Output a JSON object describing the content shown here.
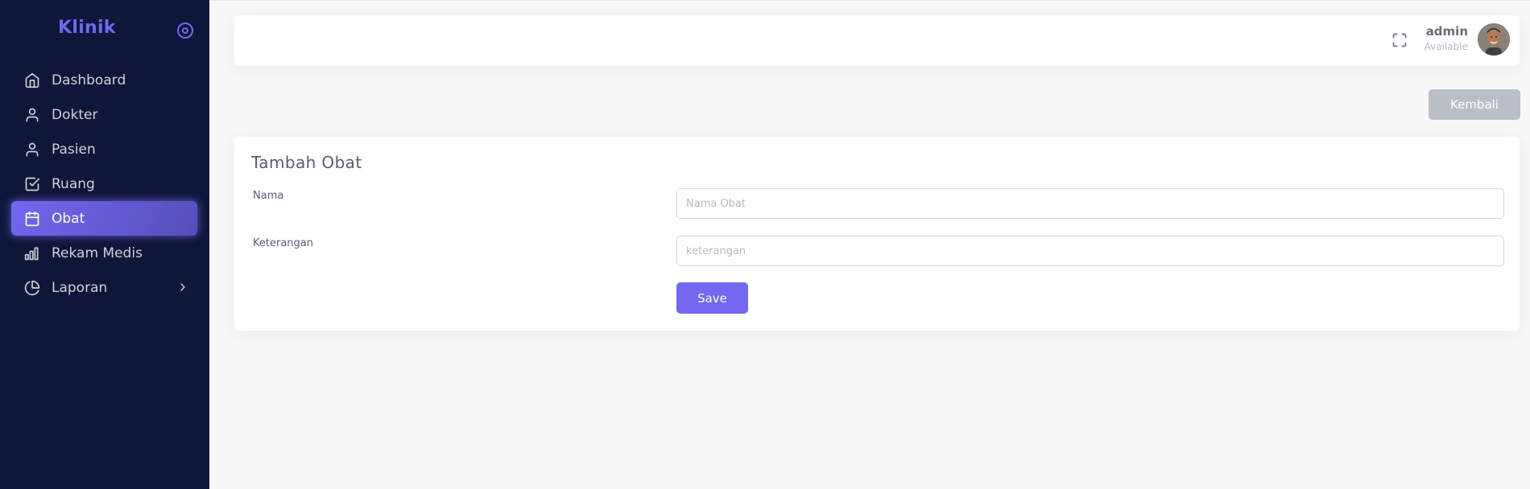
{
  "sidebar": {
    "brand": "Klinik",
    "items": [
      {
        "label": "Dashboard",
        "icon": "home-icon"
      },
      {
        "label": "Dokter",
        "icon": "user-icon"
      },
      {
        "label": "Pasien",
        "icon": "user-icon"
      },
      {
        "label": "Ruang",
        "icon": "check-square-icon"
      },
      {
        "label": "Obat",
        "icon": "calendar-icon",
        "active": true
      },
      {
        "label": "Rekam Medis",
        "icon": "bar-chart-icon"
      },
      {
        "label": "Laporan",
        "icon": "pie-chart-icon",
        "has_children": true
      }
    ]
  },
  "header": {
    "user_name": "admin",
    "user_status": "Available"
  },
  "actions": {
    "back_label": "Kembali"
  },
  "form": {
    "title": "Tambah Obat",
    "fields": [
      {
        "label": "Nama",
        "placeholder": "Nama Obat",
        "value": ""
      },
      {
        "label": "Keterangan",
        "placeholder": "keterangan",
        "value": ""
      }
    ],
    "save_label": "Save"
  },
  "colors": {
    "primary": "#7367f0",
    "sidebar_bg": "#10163a",
    "secondary": "#babfc7",
    "page_bg": "#f8f8f8"
  }
}
